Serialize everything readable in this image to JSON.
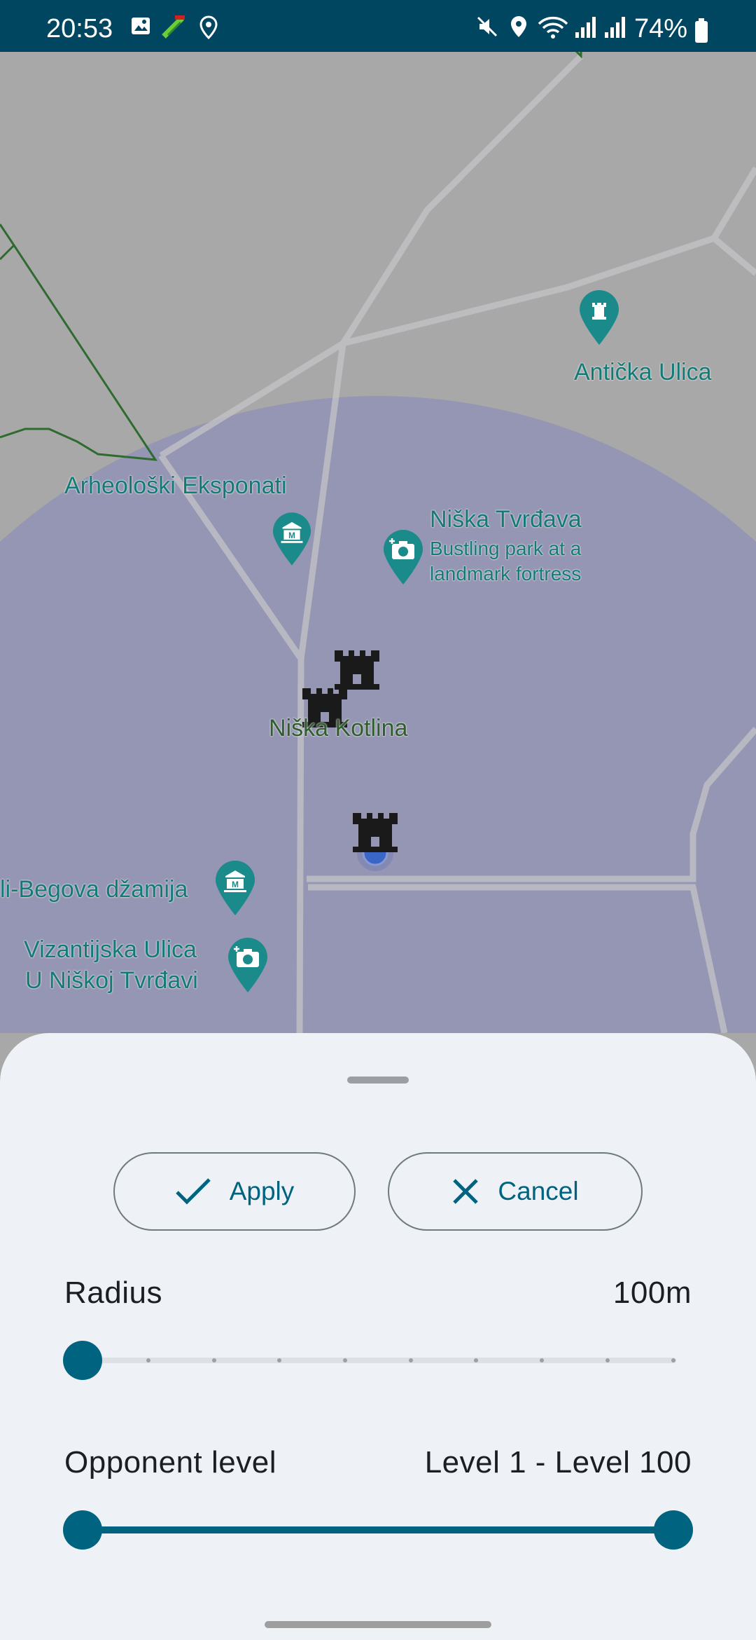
{
  "status_bar": {
    "time": "20:53",
    "battery": "74%"
  },
  "map": {
    "places": {
      "anticka": "Antička Ulica",
      "arheoloski": "Arheološki Eksponati",
      "niska_tvrdjava": "Niška Tvrđava",
      "niska_tvrdjava_desc_1": "Bustling park at a",
      "niska_tvrdjava_desc_2": "landmark fortress",
      "niska_kotlina": "Niška Kotlina",
      "dzamija": "li-Begova džamija",
      "vizantijska_1": "Vizantijska Ulica",
      "vizantijska_2": "U Niškoj Tvrđavi"
    },
    "colors": {
      "poi_teal": "#1a8a8a",
      "range_circle": "#9595b4",
      "user_dot": "#3a66c8"
    }
  },
  "sheet": {
    "apply_label": "Apply",
    "cancel_label": "Cancel",
    "radius_label": "Radius",
    "radius_value": "100m",
    "radius_level": 0,
    "opponent_label": "Opponent level",
    "opponent_value": "Level 1 - Level 100",
    "opponent_range": [
      1,
      100
    ],
    "accent": "#00637f"
  }
}
